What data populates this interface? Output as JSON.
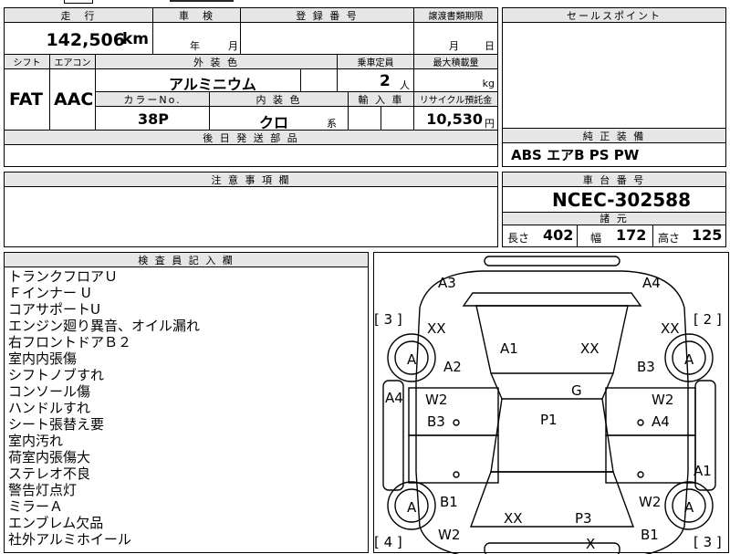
{
  "top_strip": {
    "partial_text": "…"
  },
  "headers": {
    "mileage": "走　行",
    "inspection": "車　検",
    "registration": "登 録 番 号",
    "transfer_deadline": "譲渡書類期限",
    "sales_points": "セールスポイント",
    "shift": "シフト",
    "aircon": "エアコン",
    "exterior_color": "外 装 色",
    "capacity": "乗車定員",
    "max_load": "最大積載量",
    "color_no": "カラーNo.",
    "interior_color": "内 装 色",
    "import": "輸 入 車",
    "recycle_fee": "リサイクル預託金",
    "later_parts": "後 日 発 送 部 品",
    "genuine_equipment": "純 正 装 備",
    "notes": "注 意 事 項 欄",
    "chassis_no": "車 台 番 号",
    "specs": "諸 元",
    "inspector_notes": "検 査 員 記 入 欄"
  },
  "values": {
    "mileage": "142,506",
    "mileage_unit": "km",
    "inspection_year_label": "年",
    "inspection_month_label": "月",
    "transfer_month_label": "月",
    "transfer_day_label": "日",
    "shift": "FAT",
    "aircon": "AAC",
    "exterior_color": "アルミニウム",
    "capacity": "2",
    "capacity_unit": "人",
    "load_unit": "kg",
    "color_no": "38P",
    "interior_color": "クロ",
    "interior_suffix": "系",
    "recycle_fee": "10,530",
    "recycle_unit": "円",
    "genuine_equipment": "ABS エアB PS PW",
    "chassis_no": "NCEC-302588",
    "length_label": "長さ",
    "length": "402",
    "width_label": "幅",
    "width": "172",
    "height_label": "高さ",
    "height": "125"
  },
  "inspector_remarks": [
    "トランクフロアＵ",
    "Ｆインナー U",
    "コアサポートU",
    "エンジン廻り異音、オイル漏れ",
    "右フロントドアＢ２",
    "室内内張傷",
    "シフトノブすれ",
    "コンソール傷",
    "ハンドルすれ",
    "シート張替え要",
    "室内汚れ",
    "荷室内張傷大",
    "ステレオ不良",
    "警告灯点灯",
    "ミラーＡ",
    "エンブレム欠品",
    "社外アルミホイール"
  ],
  "diagram": {
    "marks": [
      {
        "text": "A3"
      },
      {
        "text": "A4"
      },
      {
        "text": "[ 3 ]"
      },
      {
        "text": "[ 2 ]"
      },
      {
        "text": "XX"
      },
      {
        "text": "XX"
      },
      {
        "text": "A1"
      },
      {
        "text": "XX"
      },
      {
        "text": "A"
      },
      {
        "text": "A"
      },
      {
        "text": "A2"
      },
      {
        "text": "B3"
      },
      {
        "text": "G"
      },
      {
        "text": "A4"
      },
      {
        "text": "W2"
      },
      {
        "text": "W2"
      },
      {
        "text": "P1"
      },
      {
        "text": "B3"
      },
      {
        "text": "A4"
      },
      {
        "text": "A1"
      },
      {
        "text": "A"
      },
      {
        "text": "A"
      },
      {
        "text": "B1"
      },
      {
        "text": "W2"
      },
      {
        "text": "XX"
      },
      {
        "text": "P3"
      },
      {
        "text": "W2"
      },
      {
        "text": "B1"
      },
      {
        "text": "[ 4 ]"
      },
      {
        "text": "[ 3 ]"
      },
      {
        "text": "X"
      }
    ]
  }
}
